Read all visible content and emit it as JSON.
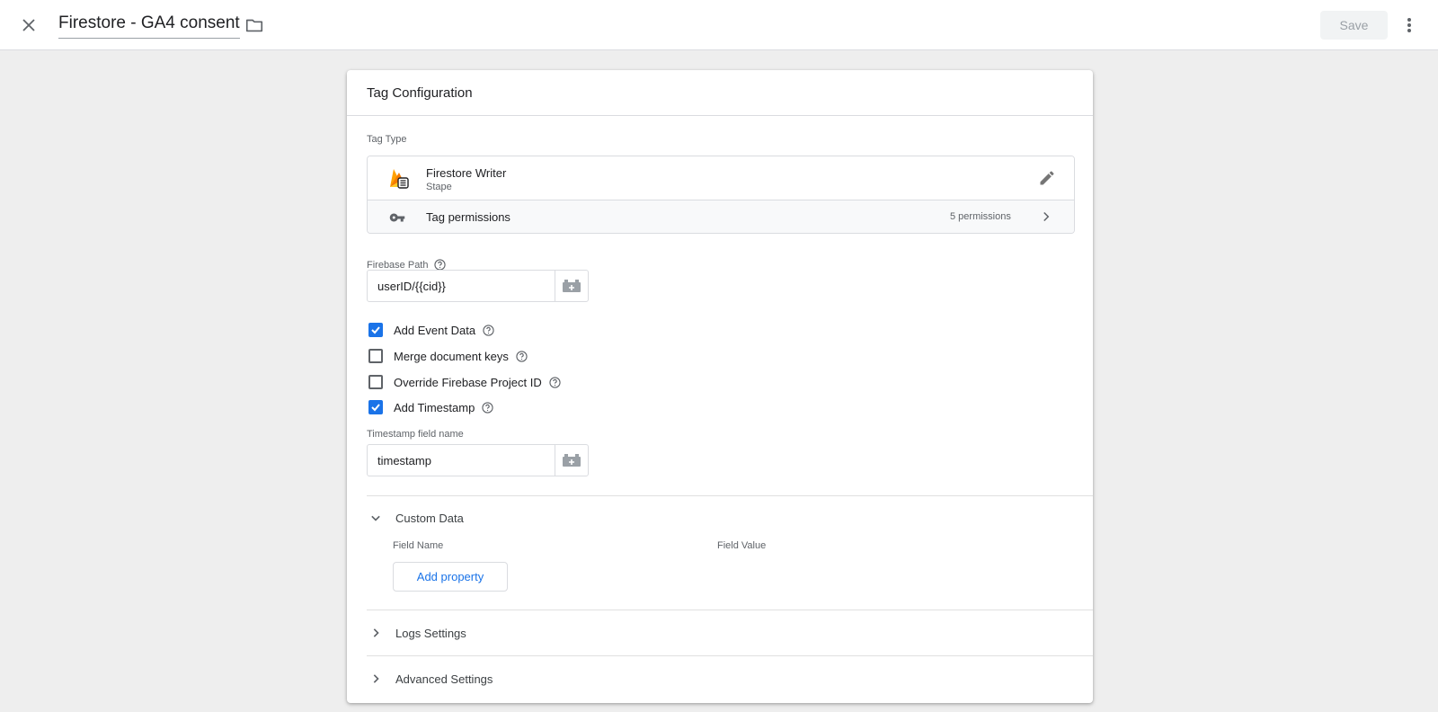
{
  "topbar": {
    "title": "Firestore - GA4 consent",
    "save_label": "Save"
  },
  "card": {
    "title": "Tag Configuration",
    "tag_type_label": "Tag Type",
    "tag_type": {
      "name": "Firestore Writer",
      "vendor": "Stape"
    },
    "permissions": {
      "label": "Tag permissions",
      "count": "5 permissions"
    },
    "firebase_path": {
      "label": "Firebase Path",
      "value": "userID/{{cid}}"
    },
    "checkboxes": [
      {
        "label": "Add Event Data",
        "checked": true
      },
      {
        "label": "Merge document keys",
        "checked": false
      },
      {
        "label": "Override Firebase Project ID",
        "checked": false
      },
      {
        "label": "Add Timestamp",
        "checked": true
      }
    ],
    "timestamp_field": {
      "label": "Timestamp field name",
      "value": "timestamp"
    },
    "custom_data": {
      "title": "Custom Data",
      "col_field_name": "Field Name",
      "col_field_value": "Field Value",
      "add_label": "Add property"
    },
    "sections": {
      "logs": "Logs Settings",
      "advanced": "Advanced Settings"
    }
  },
  "colors": {
    "accent": "#1a73e8",
    "background": "#eeeeee",
    "firebase_orange": "#f5a623"
  }
}
